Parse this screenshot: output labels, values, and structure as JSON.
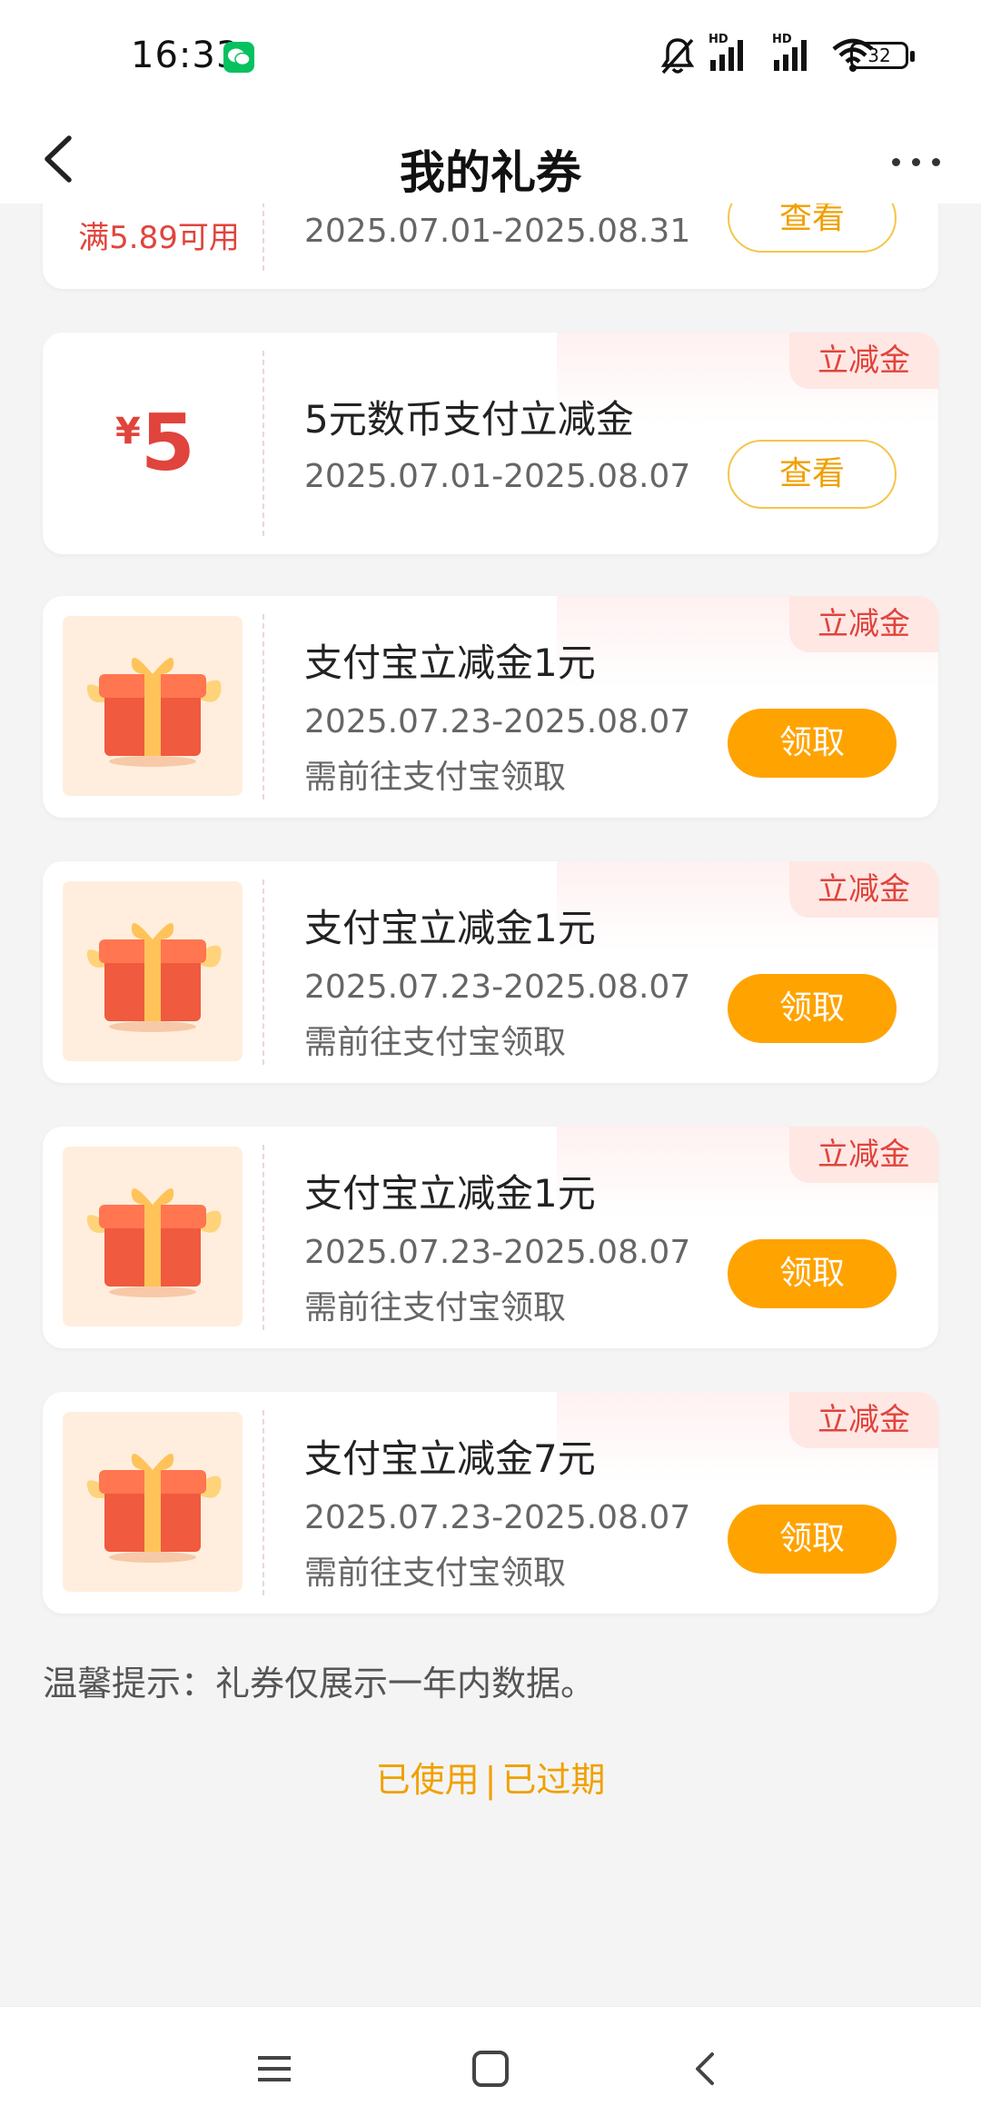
{
  "status_bar": {
    "time": "16:33",
    "battery": "32",
    "hd1": "HD",
    "hd2": "HD",
    "icons": [
      "wechat-icon",
      "mute-icon",
      "signal-icon",
      "wifi-icon",
      "battery-icon"
    ]
  },
  "header": {
    "title": "我的礼券",
    "back_icon": "chevron-left-icon",
    "more_icon": "more-dots-icon"
  },
  "cards": [
    {
      "threshold": "满5.89可用",
      "date": "2025.07.01-2025.08.31",
      "button": "查看"
    },
    {
      "tag": "立减金",
      "currency": "¥",
      "amount": "5",
      "title": "5元数币支付立减金",
      "date": "2025.07.01-2025.08.07",
      "button": "查看"
    },
    {
      "tag": "立减金",
      "title": "支付宝立减金1元",
      "date": "2025.07.23-2025.08.07",
      "note": "需前往支付宝领取",
      "button": "领取"
    },
    {
      "tag": "立减金",
      "title": "支付宝立减金1元",
      "date": "2025.07.23-2025.08.07",
      "note": "需前往支付宝领取",
      "button": "领取"
    },
    {
      "tag": "立减金",
      "title": "支付宝立减金1元",
      "date": "2025.07.23-2025.08.07",
      "note": "需前往支付宝领取",
      "button": "领取"
    },
    {
      "tag": "立减金",
      "title": "支付宝立减金7元",
      "date": "2025.07.23-2025.08.07",
      "note": "需前往支付宝领取",
      "button": "领取"
    }
  ],
  "tip": "温馨提示：礼券仅展示一年内数据。",
  "links": {
    "used": "已使用",
    "separator": "|",
    "expired": "已过期"
  },
  "nav": {
    "icons": [
      "menu-icon",
      "home-square-icon",
      "back-triangle-icon"
    ]
  },
  "colors": {
    "accent_red": "#e0443c",
    "accent_orange": "#ffa300",
    "link_orange": "#f0a000"
  }
}
